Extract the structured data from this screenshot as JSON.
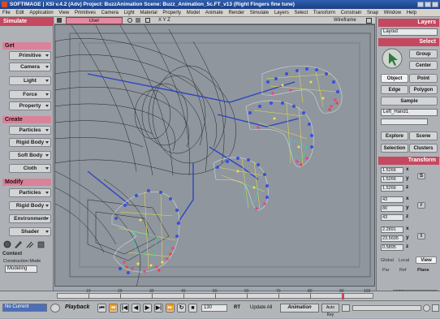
{
  "window": {
    "title": "SOFTIMAGE | XSI v.4.2 (Adv) Project: BuzzAnimation   Scene: Buzz_Animation_5c.FT_v13 (Right Fingers fine tune)"
  },
  "menubar": {
    "items": [
      "File",
      "Edit",
      "Application",
      "View",
      "Primitives",
      "Camera",
      "Light",
      "Material",
      "Property",
      "Model",
      "Animate",
      "Render",
      "Simulate",
      "Layers",
      "Select",
      "Transform",
      "Constrain",
      "Snap",
      "Window",
      "Help"
    ]
  },
  "left_panel": {
    "module": "Simulate",
    "get": {
      "header": "Get",
      "buttons": [
        "Primitive",
        "Camera",
        "Light",
        "Force",
        "Property"
      ]
    },
    "create": {
      "header": "Create",
      "buttons": [
        "Particles",
        "Rigid Body",
        "Soft Body",
        "Cloth"
      ]
    },
    "modify": {
      "header": "Modify",
      "buttons": [
        "Particles",
        "Rigid Body",
        "Environment",
        "Shader"
      ]
    },
    "context": {
      "header": "Context",
      "construction_label": "Construction Mode",
      "construction_value": "Modeling"
    }
  },
  "viewport": {
    "camera": "User",
    "xyz": "X Y Z",
    "mode": "Wireframe"
  },
  "right_panel": {
    "layers": {
      "header": "Layers",
      "value": "Layout"
    },
    "select": {
      "header": "Select",
      "group": "Group",
      "center": "Center",
      "object": "Object",
      "point": "Point",
      "edge": "Edge",
      "polygon": "Polygon",
      "sample": "Sample",
      "selection_name": "Left_Hand1",
      "explore": "Explore",
      "scene": "Scene",
      "selection": "Selection",
      "clusters": "Clusters"
    },
    "transform": {
      "header": "Transform",
      "scale": [
        "1.5266",
        "1.5266",
        "1.5266"
      ],
      "rotate": [
        "43",
        "80",
        "43"
      ],
      "translate": [
        "2.2891",
        "23.5695",
        "0.5895"
      ],
      "scale_icon": "S",
      "rotate_icon": "r",
      "translate_icon": "t",
      "axes": [
        "x",
        "y",
        "z"
      ],
      "bottom_row": [
        "Global",
        "Local",
        "View"
      ],
      "bottom_row2": [
        "Par",
        "Ref",
        "Plane"
      ]
    }
  },
  "timeline": {
    "start": "1",
    "labels": [
      "10",
      "20",
      "30",
      "40",
      "50",
      "60",
      "70",
      "80",
      "90",
      "100"
    ],
    "current": "100",
    "end_field": "120"
  },
  "playbar": {
    "current_frame_field": "1",
    "frame_label": "No Current",
    "playback_label": "Playback",
    "frame_field": "130",
    "frame_rate": "RT",
    "update_label": "Update All",
    "animation_label": "Animation",
    "auto_key": "Auto Key"
  },
  "colors": {
    "accent": "#c4485f",
    "title_bar": "#2f5fb0",
    "viewport_bg": "#8f969d",
    "panel_bg": "#aeb2b6"
  }
}
